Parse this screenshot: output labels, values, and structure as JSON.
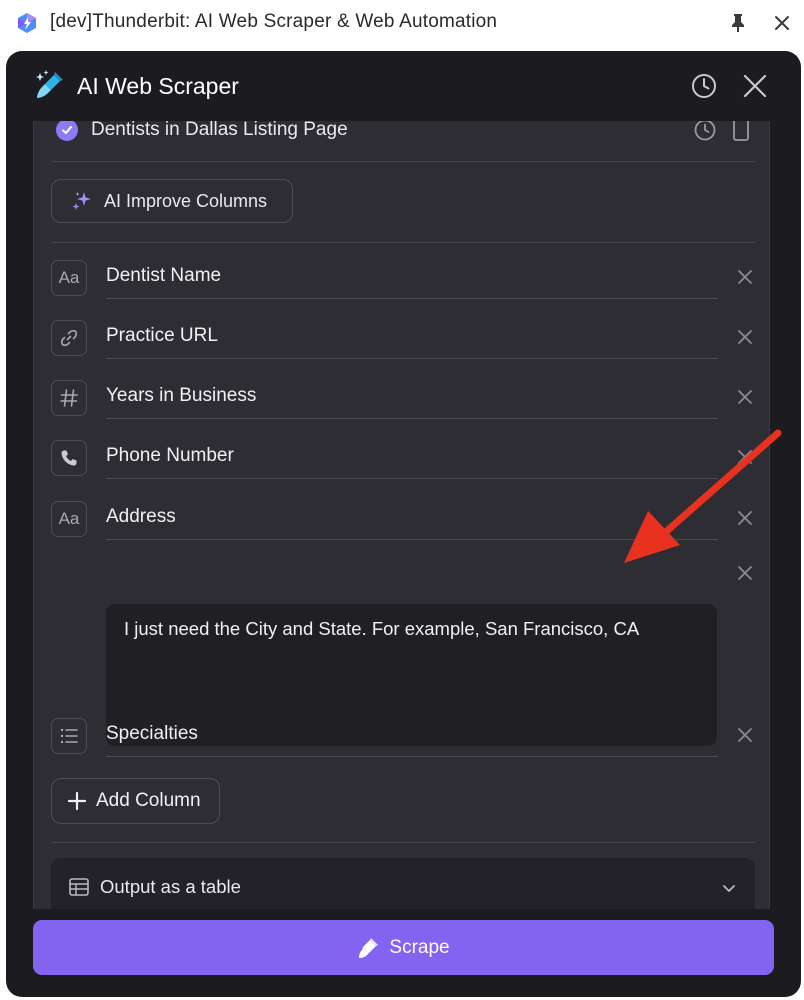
{
  "window": {
    "title": "[dev]Thunderbit: AI Web Scraper & Web Automation"
  },
  "panel": {
    "title": "AI Web Scraper"
  },
  "template": {
    "name": "Dentists in Dallas Listing Page"
  },
  "improve_button": {
    "label": "AI Improve Columns"
  },
  "columns": [
    {
      "name": "Dentist Name",
      "type_icon": "text-type-icon",
      "type_glyph": "Aa"
    },
    {
      "name": "Practice URL",
      "type_icon": "link-icon",
      "type_glyph": ""
    },
    {
      "name": "Years in Business",
      "type_icon": "number-icon",
      "type_glyph": "#"
    },
    {
      "name": "Phone Number",
      "type_icon": "phone-icon",
      "type_glyph": ""
    },
    {
      "name": "Address",
      "type_icon": "text-type-icon",
      "type_glyph": "Aa"
    },
    {
      "name": "Specialties",
      "type_icon": "list-icon",
      "type_glyph": ""
    }
  ],
  "address_prompt": {
    "value": "I just need the City and State. For example, San Francisco, CA"
  },
  "add_column_button": {
    "label": "Add Column"
  },
  "output": {
    "label": "Output as a table"
  },
  "scrape_button": {
    "label": "Scrape"
  },
  "colors": {
    "accent": "#8364f0",
    "check": "#8b7cf6",
    "annotation_arrow": "#e8321f",
    "panel_bg": "#1c1c20",
    "content_bg": "#2d2d33"
  }
}
